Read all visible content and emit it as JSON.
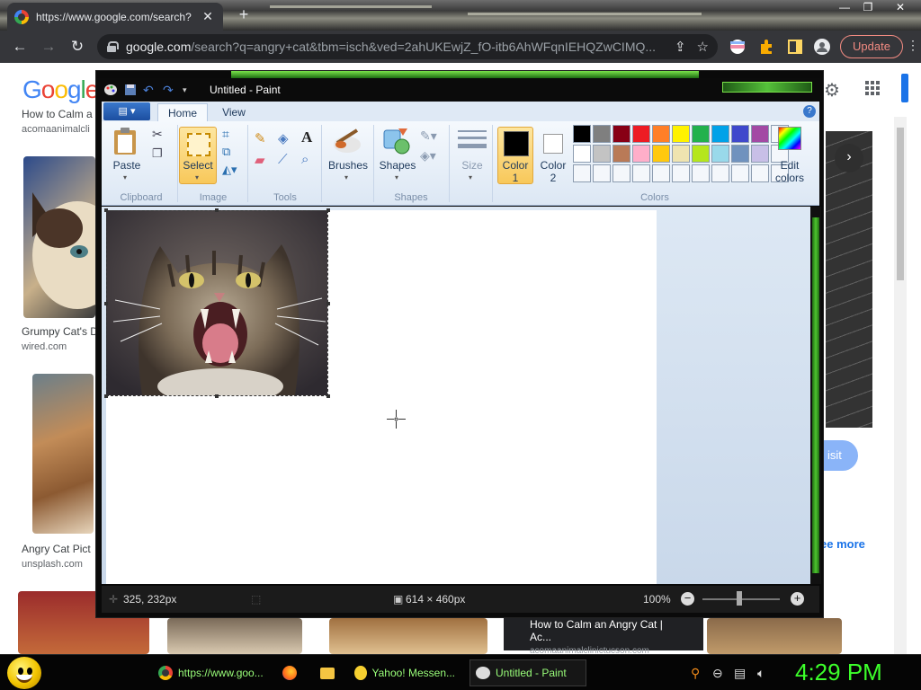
{
  "browser": {
    "tab_title": "https://www.google.com/search?",
    "tab_close": "✕",
    "new_tab": "+",
    "window_controls": [
      "—",
      "❐",
      "✕"
    ],
    "back": "←",
    "forward": "→",
    "reload": "↻",
    "url_domain": "google.com",
    "url_path": "/search?q=angry+cat&tbm=isch&ved=2ahUKEwjZ_fO-itb6AhWFqnIEHQZwCIMQ...",
    "update_label": "Update",
    "menu": "⋮"
  },
  "google": {
    "logo": [
      "G",
      "o",
      "o",
      "g",
      "l",
      "e"
    ],
    "top_title": "How to Calm a",
    "top_source": "acomaanimalcli",
    "results": [
      {
        "title": "Grumpy Cat's D",
        "source": "wired.com"
      },
      {
        "title": "Angry Cat Pict",
        "source": "unsplash.com"
      }
    ],
    "visit_label": "isit",
    "see_more_label": "ee more",
    "bottom_caption_title": "How to Calm an Angry Cat | Ac...",
    "bottom_caption_source": "acomaanimalclinictucson.com"
  },
  "paint": {
    "title": "Untitled - Paint",
    "tabs": [
      "Home",
      "View"
    ],
    "help": "?",
    "groups": {
      "clipboard": "Clipboard",
      "image": "Image",
      "tools": "Tools",
      "shapes": "Shapes",
      "colors": "Colors"
    },
    "paste_label": "Paste",
    "select_label": "Select",
    "brushes_label": "Brushes",
    "shapes_label": "Shapes",
    "size_label": "Size",
    "color1_label": [
      "Color",
      "1"
    ],
    "color2_label": [
      "Color",
      "2"
    ],
    "edit_colors_label": [
      "Edit",
      "colors"
    ],
    "palette": [
      "#000000",
      "#7f7f7f",
      "#880015",
      "#ed1c24",
      "#ff7f27",
      "#fff200",
      "#22b14c",
      "#00a2e8",
      "#3f48cc",
      "#a349a4",
      "",
      "#ffffff",
      "#c3c3c3",
      "#b97a57",
      "#ffaec9",
      "#ffc90e",
      "#efe4b0",
      "#b5e61d",
      "#99d9ea",
      "#7092be",
      "#c8bfe7",
      "",
      "",
      "",
      "",
      "",
      "",
      "",
      "",
      "",
      "",
      "",
      ""
    ],
    "status": {
      "cursor_pos": "325, 232px",
      "image_size": "614 × 460px",
      "zoom": "100%"
    }
  },
  "taskbar": {
    "items": [
      "https://www.goo...",
      "",
      "",
      "Yahoo! Messen...",
      "Untitled - Paint"
    ],
    "clock": "4:29 PM"
  },
  "colors": {
    "taskbar_text": "#9aff7a",
    "clock": "#3cff2a",
    "paint_glow": "#7ae34a"
  }
}
